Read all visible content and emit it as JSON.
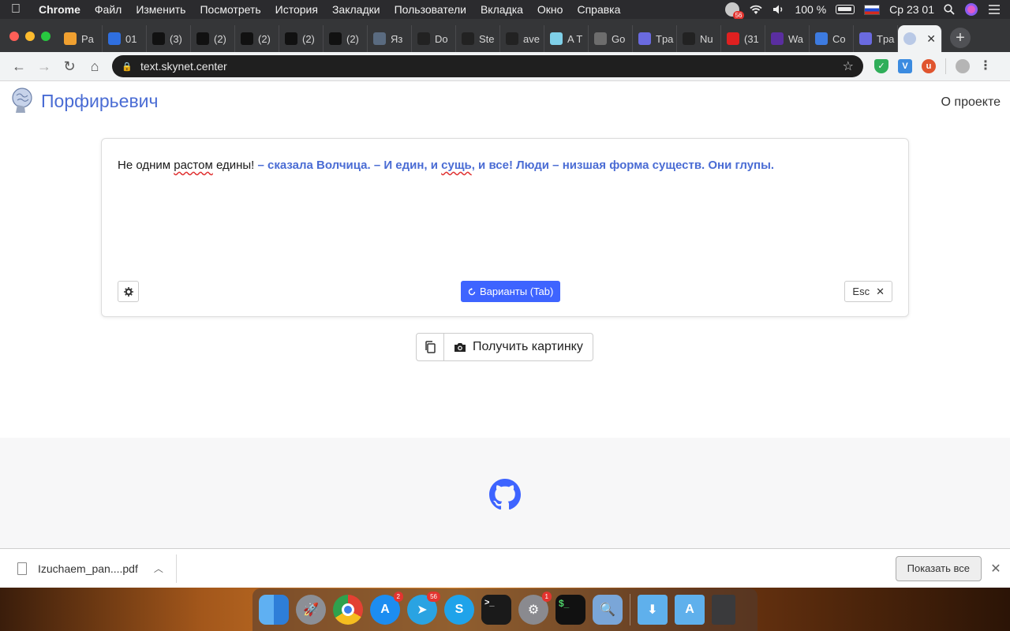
{
  "menubar": {
    "app": "Chrome",
    "items": [
      "Файл",
      "Изменить",
      "Посмотреть",
      "История",
      "Закладки",
      "Пользователи",
      "Вкладка",
      "Окно",
      "Справка"
    ],
    "notif_count": "56",
    "battery": "100 %",
    "clock": "Ср 23 01"
  },
  "tabs": [
    {
      "label": "Pa",
      "color": "#f0a030"
    },
    {
      "label": "01",
      "color": "#2f6fe0"
    },
    {
      "label": "(3)",
      "color": "#111111"
    },
    {
      "label": "(2)",
      "color": "#111111"
    },
    {
      "label": "(2)",
      "color": "#111111"
    },
    {
      "label": "(2)",
      "color": "#111111"
    },
    {
      "label": "(2)",
      "color": "#111111"
    },
    {
      "label": "Яз",
      "color": "#5a6b80"
    },
    {
      "label": "Do",
      "color": "#222222"
    },
    {
      "label": "Ste",
      "color": "#222222"
    },
    {
      "label": "ave",
      "color": "#222222"
    },
    {
      "label": "A T",
      "color": "#7fd0e8"
    },
    {
      "label": "Go",
      "color": "#6d6d6d"
    },
    {
      "label": "Tpa",
      "color": "#6a6ae0"
    },
    {
      "label": "Nu",
      "color": "#222222"
    },
    {
      "label": "(31",
      "color": "#e02020"
    },
    {
      "label": "Wa",
      "color": "#5a2ea0"
    },
    {
      "label": "Co",
      "color": "#3d7be0"
    },
    {
      "label": "Tpa",
      "color": "#6a6ae0"
    }
  ],
  "browser": {
    "url": "text.skynet.center"
  },
  "site": {
    "brand": "Порфирьевич",
    "about": "О проекте"
  },
  "editor": {
    "text_before": "Не одним ",
    "typo1": "растом",
    "text_mid": " едины! ",
    "generated_1": "– сказала Волчица. – И един, и ",
    "typo2": "сущь",
    "generated_2": ", и все! Люди – низшая форма существ. Они глупы.",
    "variants_label": "Варианты (Tab)",
    "esc_label": "Esc"
  },
  "actions": {
    "get_picture": "Получить картинку"
  },
  "downloads": {
    "file": "Izuchaem_pan....pdf",
    "show_all": "Показать все"
  },
  "dock": {
    "appstore_badge": "2",
    "telegram_badge": "56",
    "prefs_badge": "1"
  }
}
